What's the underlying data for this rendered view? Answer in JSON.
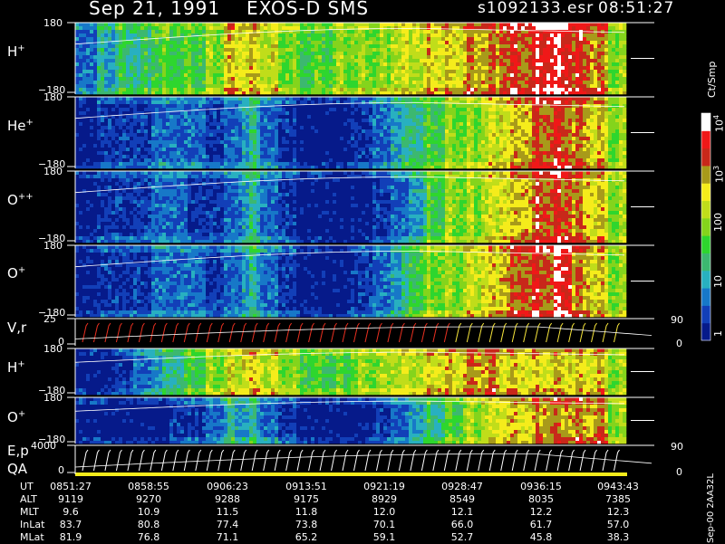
{
  "header": {
    "date": "Sep 21, 1991",
    "mission": "EXOS-D SMS",
    "file": "s1092133.esr",
    "time": "08:51:27"
  },
  "colors": {
    "background": "#000000",
    "scale": [
      "#061a8a",
      "#123fb8",
      "#1778c8",
      "#28b0c0",
      "#3cb870",
      "#2ed62e",
      "#84d41c",
      "#c0dd1a",
      "#f5ec1b",
      "#a89a1a",
      "#c8281a",
      "#f01818",
      "#ffffff"
    ]
  },
  "colorbar": {
    "unit_label": "Ct/Smp",
    "ticks": [
      "1",
      "10",
      "100",
      "10",
      "10"
    ],
    "tick_exponents": [
      "",
      "",
      "",
      "3",
      "4"
    ]
  },
  "panels": [
    {
      "id": "h_plus",
      "label": "H",
      "sup": "+",
      "y_top": "180",
      "y_bot": "−180"
    },
    {
      "id": "he_plus",
      "label": "He",
      "sup": "+",
      "y_top": "180",
      "y_bot": "−180"
    },
    {
      "id": "o_plus_plus",
      "label": "O",
      "sup": "++",
      "y_top": "180",
      "y_bot": "−180"
    },
    {
      "id": "o_plus",
      "label": "O",
      "sup": "+",
      "y_top": "180",
      "y_bot": "−180"
    },
    {
      "id": "vr",
      "label": "V,r",
      "sup": "",
      "y_top": "25",
      "y_bot": "0",
      "right_top": "90",
      "right_bot": "0"
    },
    {
      "id": "h_plus_2",
      "label": "H",
      "sup": "+",
      "y_top": "180",
      "y_bot": "−180"
    },
    {
      "id": "o_plus_2",
      "label": "O",
      "sup": "+",
      "y_top": "180",
      "y_bot": "−180"
    },
    {
      "id": "ep",
      "label": "E,p",
      "label2": "QA",
      "sup": "",
      "y_top": "4000",
      "y_bot": "0",
      "right_top": "90",
      "right_bot": "0"
    }
  ],
  "footer": {
    "rows": [
      {
        "label": "UT",
        "values": [
          "0851:27",
          "0858:55",
          "0906:23",
          "0913:51",
          "0921:19",
          "0928:47",
          "0936:15",
          "0943:43"
        ]
      },
      {
        "label": "ALT",
        "values": [
          "9119",
          "9270",
          "9288",
          "9175",
          "8929",
          "8549",
          "8035",
          "7385"
        ]
      },
      {
        "label": "MLT",
        "values": [
          "9.6",
          "10.9",
          "11.5",
          "11.8",
          "12.0",
          "12.1",
          "12.2",
          "12.3"
        ]
      },
      {
        "label": "InLat",
        "values": [
          "83.7",
          "80.8",
          "77.4",
          "73.8",
          "70.1",
          "66.0",
          "61.7",
          "57.0"
        ]
      },
      {
        "label": "MLat",
        "values": [
          "81.9",
          "76.8",
          "71.1",
          "65.2",
          "59.1",
          "52.7",
          "45.8",
          "38.3"
        ]
      }
    ],
    "side_note": "Sep-00 2AA32L"
  },
  "chart_data": {
    "type": "heatmap",
    "title": "Sep 21, 1991   EXOS-D SMS",
    "x_label": "UT",
    "x_ticks": [
      "0851:27",
      "0858:55",
      "0906:23",
      "0913:51",
      "0921:19",
      "0928:47",
      "0936:15",
      "0943:43"
    ],
    "color_unit": "Ct/Smp",
    "color_scale": "log",
    "color_range": [
      1,
      10000
    ],
    "panels_y_range": {
      "h_plus": [
        -180,
        180
      ],
      "he_plus": [
        -180,
        180
      ],
      "o_plus_plus": [
        -180,
        180
      ],
      "o_plus": [
        -180,
        180
      ],
      "vr": [
        0,
        25
      ],
      "h_plus_2": [
        -180,
        180
      ],
      "o_plus_2": [
        -180,
        180
      ],
      "ep": [
        0,
        4000
      ]
    },
    "intensity_profile": {
      "description_bins": 30,
      "h_plus": [
        2,
        3,
        4,
        4,
        5,
        5,
        5,
        6,
        8,
        8,
        7,
        6,
        5,
        5,
        6,
        6,
        6,
        7,
        7,
        8,
        8,
        9,
        9,
        10,
        10,
        11,
        11,
        10,
        9,
        6
      ],
      "he_plus": [
        0,
        1,
        1,
        1,
        2,
        2,
        2,
        1,
        2,
        3,
        2,
        1,
        0,
        0,
        0,
        1,
        2,
        3,
        4,
        5,
        6,
        6,
        7,
        8,
        9,
        10,
        10,
        9,
        8,
        6
      ],
      "o_plus_plus": [
        0,
        1,
        1,
        1,
        2,
        2,
        1,
        1,
        2,
        3,
        2,
        1,
        0,
        0,
        0,
        0,
        1,
        2,
        3,
        5,
        6,
        6,
        7,
        8,
        9,
        10,
        10,
        9,
        8,
        6
      ],
      "o_plus": [
        0,
        1,
        1,
        1,
        2,
        2,
        2,
        1,
        2,
        3,
        2,
        1,
        0,
        0,
        0,
        1,
        2,
        3,
        5,
        6,
        6,
        7,
        8,
        9,
        10,
        10,
        11,
        9,
        8,
        6
      ],
      "h_plus_2": [
        0,
        0,
        1,
        2,
        3,
        4,
        5,
        6,
        7,
        8,
        7,
        6,
        5,
        5,
        5,
        6,
        6,
        7,
        7,
        8,
        8,
        9,
        9,
        8,
        8,
        8,
        8,
        8,
        8,
        6
      ],
      "o_plus_2": [
        0,
        0,
        0,
        0,
        0,
        1,
        1,
        2,
        3,
        3,
        2,
        1,
        0,
        0,
        0,
        0,
        1,
        2,
        3,
        4,
        5,
        6,
        7,
        8,
        8,
        9,
        9,
        9,
        9,
        6
      ]
    }
  }
}
